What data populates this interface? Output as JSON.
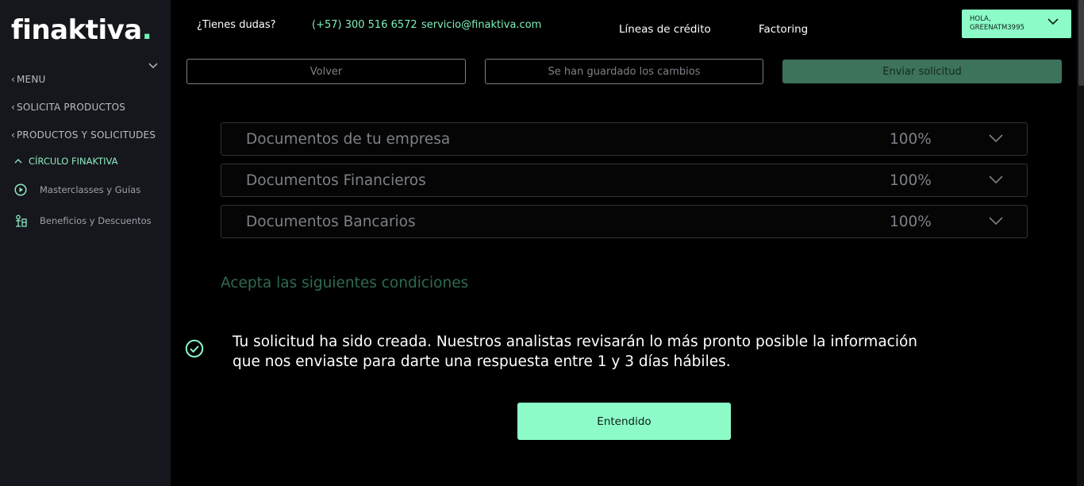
{
  "brand": {
    "name": "finaktiva",
    "dot": "."
  },
  "sidebar": {
    "menu_label": "MENU",
    "items": [
      {
        "label": "SOLICITA PRODUCTOS"
      },
      {
        "label": "PRODUCTOS Y SOLICITUDES"
      }
    ],
    "circle": {
      "label": "CÍRCULO FINAKTIVA"
    },
    "sub_items": [
      {
        "label": "Masterclasses y Guías",
        "icon": "play-circle-icon"
      },
      {
        "label": "Beneficios y Descuentos",
        "icon": "benefits-icon"
      }
    ]
  },
  "header": {
    "question": "¿Tienes dudas?",
    "phone": "(+57) 300 516 6572",
    "email": "servicio@finaktiva.com",
    "links": [
      "Líneas de crédito",
      "Factoring"
    ],
    "user": {
      "greeting": "HOLA,",
      "name": "GREENATM3995"
    }
  },
  "actions": {
    "back": "Volver",
    "saved": "Se han guardado los cambios",
    "send": "Enviar solicitud"
  },
  "documents": [
    {
      "label": "Documentos de tu empresa",
      "progress": "100%"
    },
    {
      "label": "Documentos Financieros",
      "progress": "100%"
    },
    {
      "label": "Documentos Bancarios",
      "progress": "100%"
    }
  ],
  "conditions_title": "Acepta las siguientes condiciones",
  "notice": {
    "line1": "Tu solicitud ha sido creada. Nuestros analistas revisarán lo más pronto posible la información",
    "line2": "que nos enviaste para darte una respuesta entre 1 y 3 días hábiles."
  },
  "confirm_button": "Entendido",
  "colors": {
    "accent": "#8dfbc8",
    "accent_text": "#7ff0bd",
    "sidebar_bg": "#15171c",
    "send_button": "#3c735a",
    "conditions": "#2f6a4f"
  }
}
